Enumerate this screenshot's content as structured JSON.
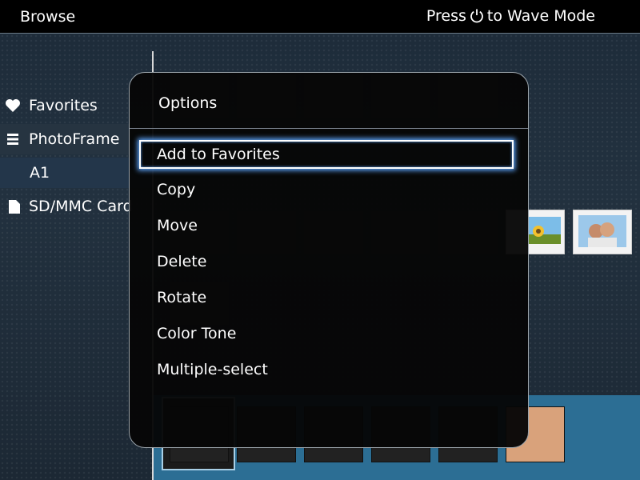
{
  "header": {
    "title": "Browse",
    "hint_prefix": "Press",
    "hint_icon": "power-icon",
    "hint_suffix": "to Wave Mode"
  },
  "sidebar": {
    "items": [
      {
        "label": "Favorites",
        "icon": "heart-icon"
      },
      {
        "label": "PhotoFrame",
        "icon": "list-icon"
      },
      {
        "label": "A1",
        "icon": ""
      },
      {
        "label": "SD/MMC Card",
        "icon": "card-icon"
      }
    ]
  },
  "dialog": {
    "title": "Options",
    "items": [
      {
        "label": "Add to Favorites",
        "selected": true
      },
      {
        "label": "Copy"
      },
      {
        "label": "Move"
      },
      {
        "label": "Delete"
      },
      {
        "label": "Rotate"
      },
      {
        "label": "Color Tone"
      },
      {
        "label": "Multiple-select"
      }
    ]
  },
  "colors": {
    "topbar": "#000000",
    "dialog_bg": "#060606",
    "selection_glow": "#5fa7ff",
    "filmstrip": "#2c6e94"
  }
}
